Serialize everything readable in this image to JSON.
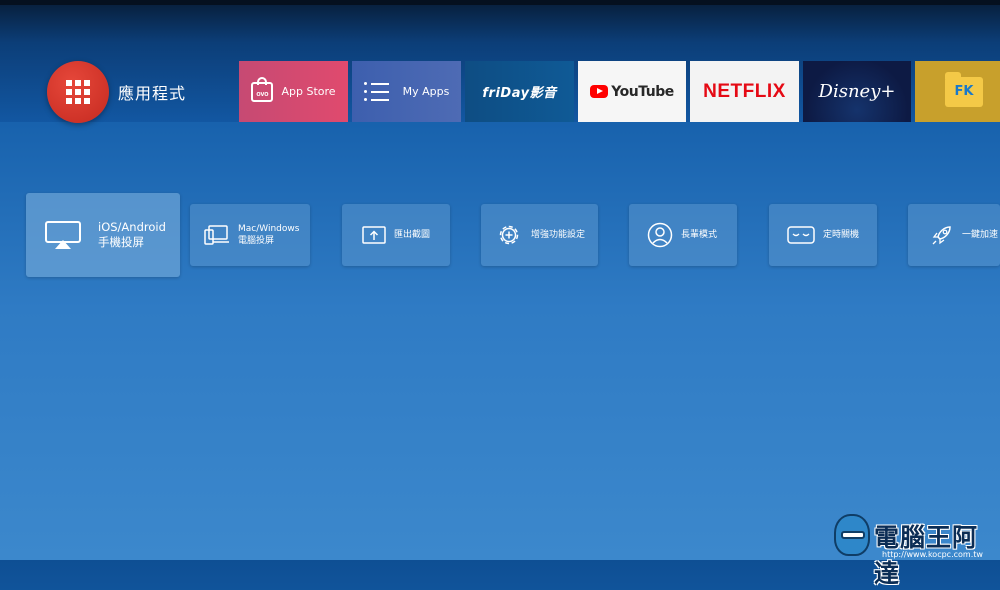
{
  "header": {
    "apps_label": "應用程式"
  },
  "apps": [
    {
      "label": "App Store",
      "badge": "OVO"
    },
    {
      "label": "My Apps"
    },
    {
      "label": "friDay影音"
    },
    {
      "label": "YouTube"
    },
    {
      "label": "NETFLIX"
    },
    {
      "label": "Disney+"
    },
    {
      "label": "FK"
    }
  ],
  "features": [
    {
      "line1": "iOS/Android",
      "line2": "手機投屏"
    },
    {
      "line1": "Mac/Windows",
      "line2": "電腦投屏"
    },
    {
      "label": "匯出截圖"
    },
    {
      "label": "增強功能設定"
    },
    {
      "label": "長輩模式"
    },
    {
      "label": "定時關機"
    },
    {
      "label": "一鍵加速"
    }
  ],
  "watermark": {
    "title": "電腦王阿達",
    "url": "http://www.kocpc.com.tw"
  },
  "colors": {
    "apps_button": "#d4362b",
    "store_tile": "#d94a70",
    "netflix_red": "#e50914",
    "youtube_red": "#ff0000",
    "fk_tile": "#c8a02c"
  }
}
